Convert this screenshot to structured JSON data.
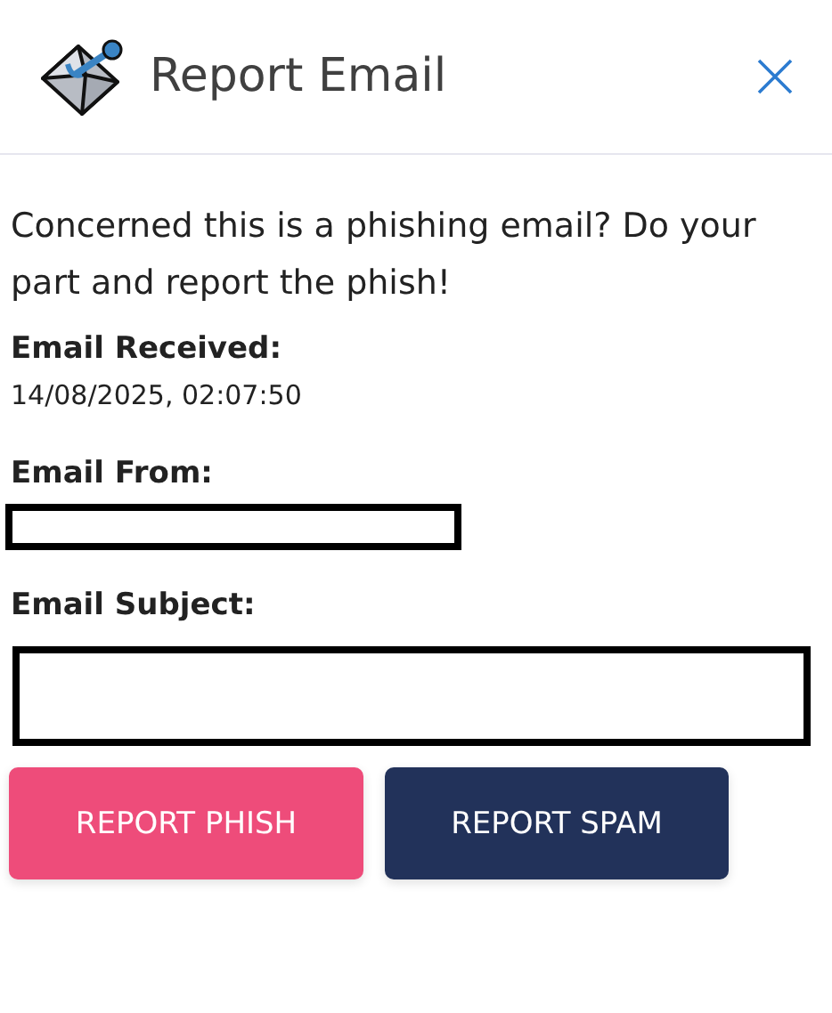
{
  "header": {
    "title": "Report Email"
  },
  "intro": "Concerned this is a phishing email? Do your part and report the phish!",
  "fields": [
    {
      "label": "Email Received:",
      "value": "14/08/2025, 02:07:50"
    },
    {
      "label": "Email From:",
      "redacted": true
    },
    {
      "label": "Email Subject:",
      "redacted": true
    }
  ],
  "buttons": [
    {
      "label": "REPORT PHISH",
      "kind": "danger"
    },
    {
      "label": "REPORT SPAM",
      "kind": "primary"
    }
  ]
}
